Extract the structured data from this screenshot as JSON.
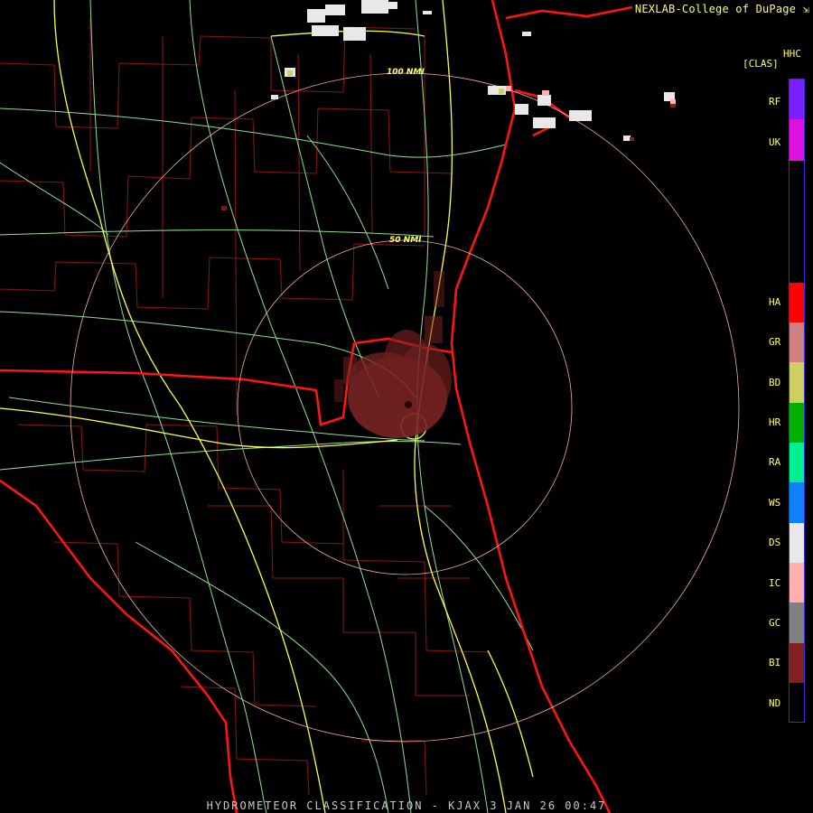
{
  "header": {
    "brand": "NEXLAB-College of DuPage",
    "product_code": "HHC",
    "product_class": "[CLAS]"
  },
  "footer": {
    "caption": "HYDROMETEOR CLASSIFICATION - KJAX 3 JAN 26 00:47"
  },
  "range_rings": [
    {
      "label": "50 NMI"
    },
    {
      "label": "100 NMI"
    }
  ],
  "legend": [
    {
      "code": "RF",
      "color": "#7a1fff"
    },
    {
      "code": "UK",
      "color": "#e010e0"
    },
    {
      "code": "HA",
      "color": "#ff0000"
    },
    {
      "code": "GR",
      "color": "#d08080"
    },
    {
      "code": "BD",
      "color": "#d0d060"
    },
    {
      "code": "HR",
      "color": "#00b000"
    },
    {
      "code": "RA",
      "color": "#00f090"
    },
    {
      "code": "WS",
      "color": "#1080ff"
    },
    {
      "code": "DS",
      "color": "#e8e8e8"
    },
    {
      "code": "IC",
      "color": "#ffb0b0"
    },
    {
      "code": "GC",
      "color": "#808080"
    },
    {
      "code": "BI",
      "color": "#802020"
    },
    {
      "code": "ND",
      "color": "#000000"
    }
  ],
  "colors": {
    "state_lines": "#ff1010",
    "county_lines": "#b01818",
    "highways": "#ffff40",
    "roads": "#90e890",
    "rings": "#f0b0a0",
    "clutter": "#7a2424"
  }
}
